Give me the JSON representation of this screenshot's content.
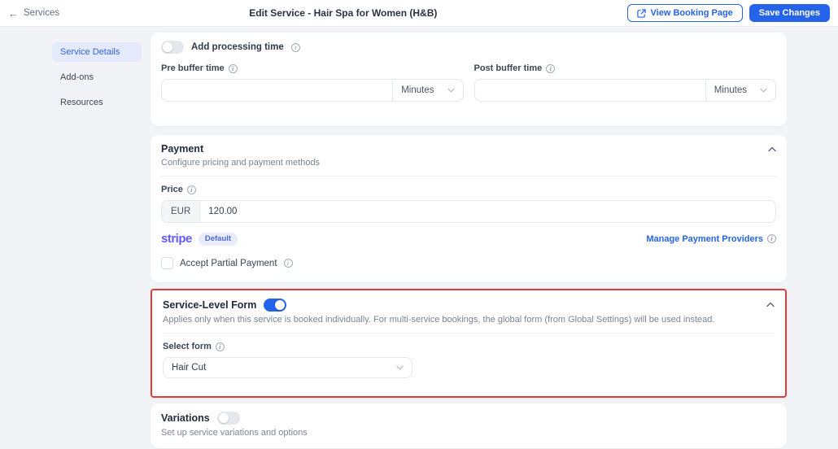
{
  "header": {
    "back_label": "Services",
    "title": "Edit Service - Hair Spa for Women (H&B)",
    "view_booking_label": "View Booking Page",
    "save_label": "Save Changes"
  },
  "sidebar": {
    "items": [
      {
        "label": "Service Details",
        "active": true
      },
      {
        "label": "Add-ons",
        "active": false
      },
      {
        "label": "Resources",
        "active": false
      }
    ]
  },
  "scheduling_card": {
    "processing_toggle_label": "Add processing time",
    "processing_toggle_on": false,
    "pre_buffer_label": "Pre buffer time",
    "post_buffer_label": "Post buffer time",
    "pre_buffer_value": "",
    "post_buffer_value": "",
    "unit_selected": "Minutes"
  },
  "payment_card": {
    "title": "Payment",
    "subtitle": "Configure pricing and payment methods",
    "price_label": "Price",
    "currency": "EUR",
    "price_value": "120.00",
    "provider_name": "stripe",
    "provider_badge": "Default",
    "manage_link": "Manage Payment Providers",
    "partial_payment_label": "Accept Partial Payment",
    "partial_payment_checked": false
  },
  "service_form_card": {
    "title": "Service-Level Form",
    "toggle_on": true,
    "description": "Applies only when this service is booked individually. For multi-service bookings, the global form (from Global Settings) will be used instead.",
    "select_form_label": "Select form",
    "selected_form": "Hair Cut"
  },
  "variations_card": {
    "title": "Variations",
    "toggle_on": false,
    "subtitle": "Set up service variations and options"
  },
  "colors": {
    "accent_blue": "#2563eb",
    "highlight_red": "#e23b3b",
    "stripe_purple": "#635bff",
    "page_background": "#f2f3f7"
  }
}
